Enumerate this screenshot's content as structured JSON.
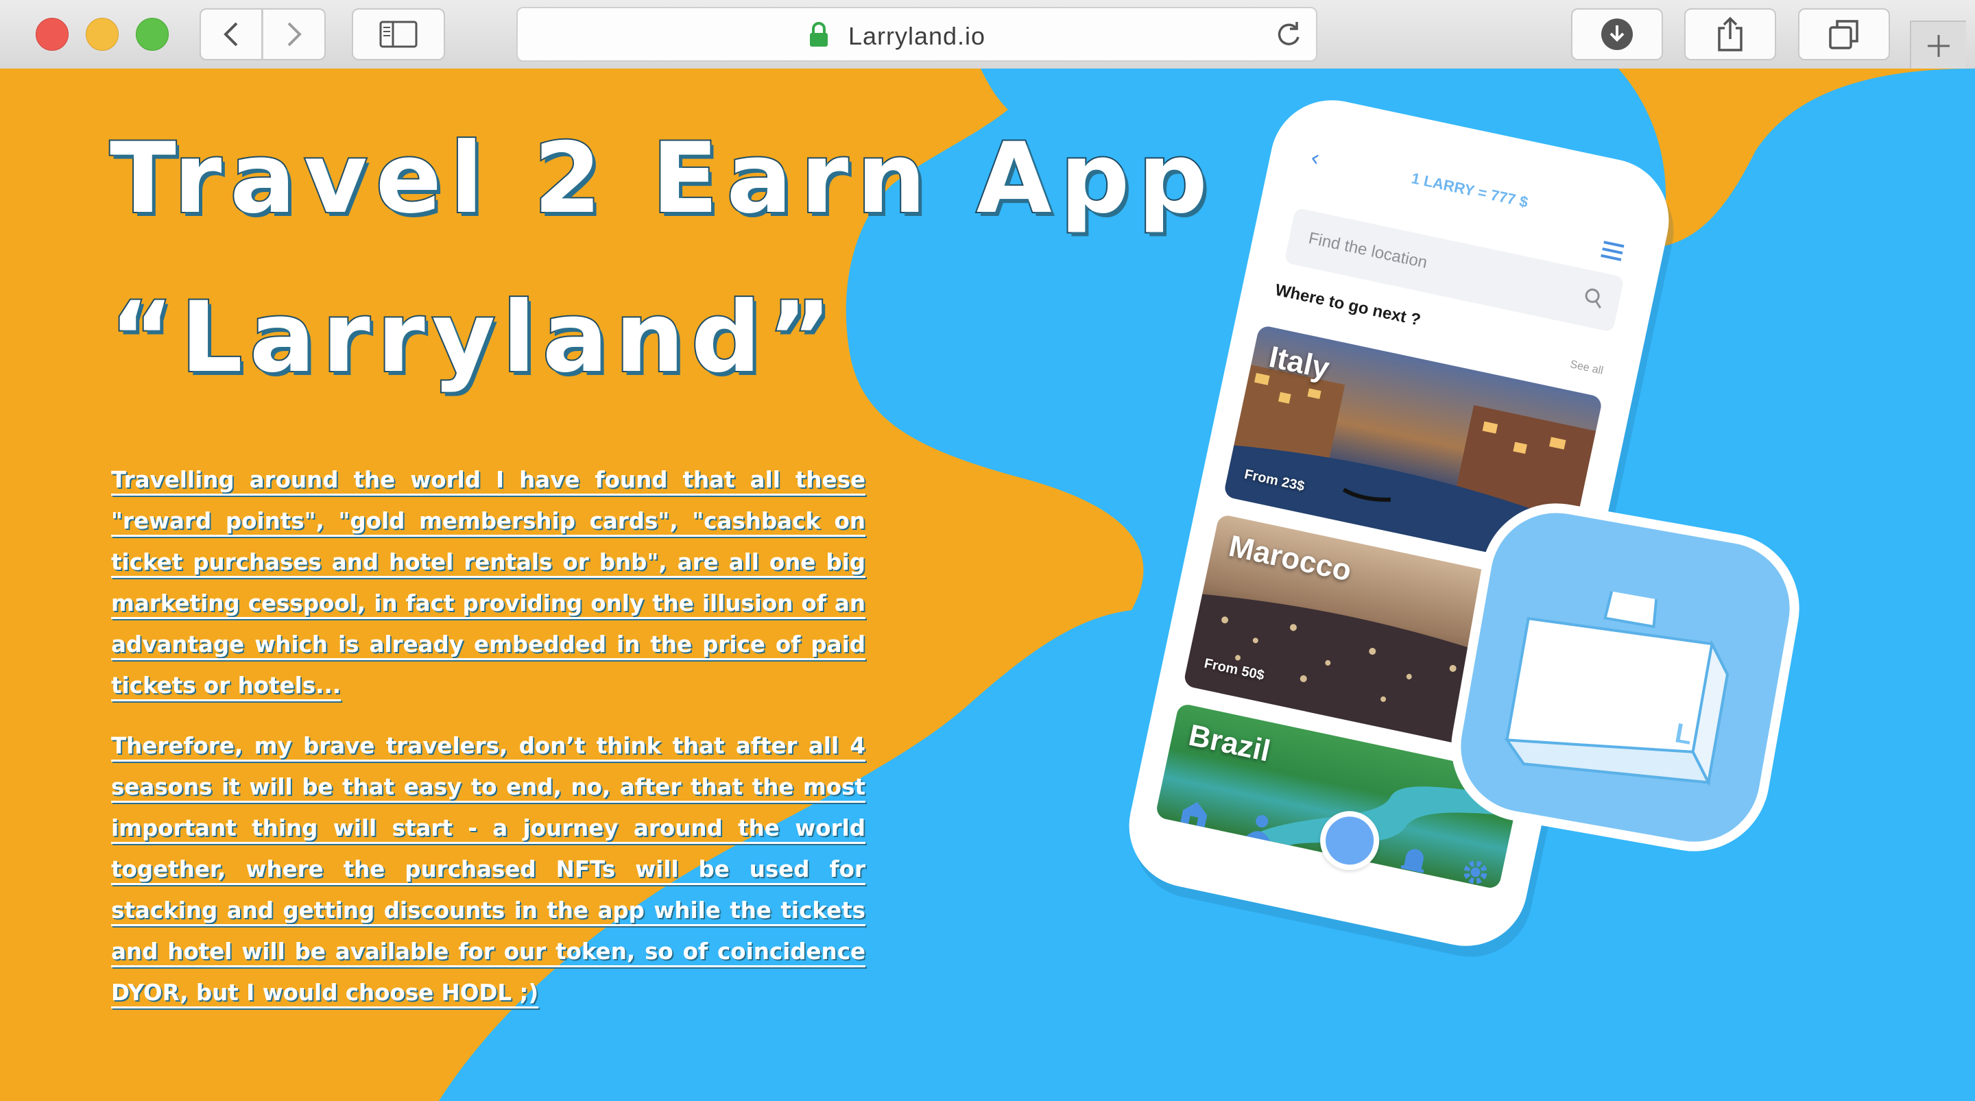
{
  "browser": {
    "url": "Larryland.io",
    "icons": {
      "back": "chevron-left-icon",
      "forward": "chevron-right-icon",
      "sidebar": "sidebar-icon",
      "lock": "lock-icon",
      "reload": "reload-icon",
      "download": "download-icon",
      "share": "share-icon",
      "tabs": "tabs-icon",
      "new_tab": "plus-icon"
    }
  },
  "hero": {
    "title_line1": "Travel 2 Earn App",
    "title_line2": "“Larryland”",
    "paragraph1": "Travelling around the world I have found that all these \"reward points\", \"gold membership cards\", \"cashback on ticket purchases and hotel rentals or bnb\", are all one big marketing cesspool, in fact providing only the illusion of an advantage which is already embedded in the price of paid tickets or hotels...",
    "paragraph2": "Therefore, my brave travelers, don’t think that after all 4 seasons it will be that easy to end, no, after that the most important thing will start - a journey around the world together, where the purchased NFTs will be used for stacking and getting discounts in the app while the tickets and hotel will be available for our token, so of coincidence DYOR, but I would choose HODL ;)"
  },
  "phone": {
    "rate": "1 LARRY = 777 $",
    "search_placeholder": "Find the location",
    "section_title": "Where to go next ?",
    "see_all": "See all",
    "destinations": [
      {
        "name": "Italy",
        "price": "From 23$"
      },
      {
        "name": "Marocco",
        "price": "From 50$"
      },
      {
        "name": "Brazil",
        "price": ""
      }
    ],
    "tabbar_icons": [
      "home-icon",
      "profile-icon",
      "bell-icon",
      "settings-icon"
    ]
  },
  "app_icon": {
    "letter": "L"
  },
  "colors": {
    "page_orange": "#f3a81f",
    "page_blue": "#35b7f9",
    "accent_blue": "#4a90e2",
    "title_outline": "#1f4b63"
  }
}
